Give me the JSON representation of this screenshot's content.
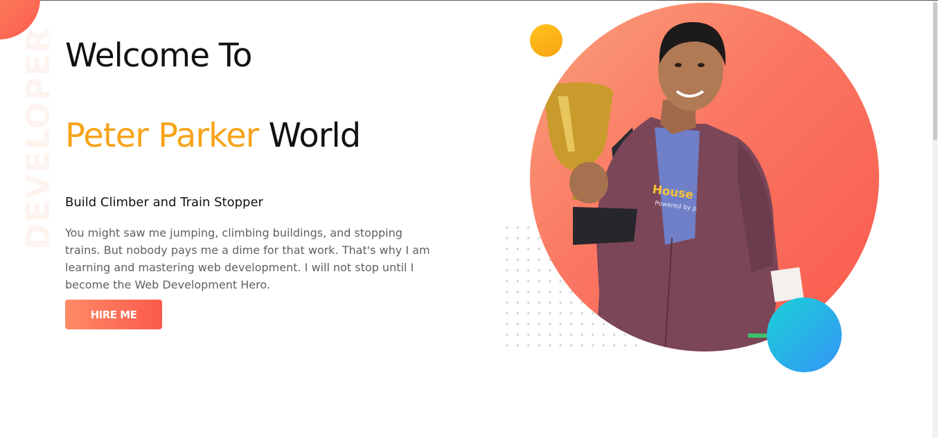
{
  "hero": {
    "side_word": "DEVELOPER",
    "welcome": "Welcome To",
    "name_highlight": "Peter Parker",
    "name_rest": "World",
    "subtitle": "Build Climber and Train Stopper",
    "bio": "You might saw me jumping, climbing buildings, and stopping trains. But nobody pays me a dime for that work. That's why I am learning and mastering web development. I will not stop until I become the Web Development Hero.",
    "cta_label": "HIRE ME"
  },
  "portrait": {
    "shirt_text": "House",
    "shirt_subtext": "Powered by p"
  },
  "colors": {
    "accent_orange": "#f7a31a",
    "coral": "#fb5a4c",
    "cyan": "#1ad1d6",
    "blue": "#3595f6"
  }
}
